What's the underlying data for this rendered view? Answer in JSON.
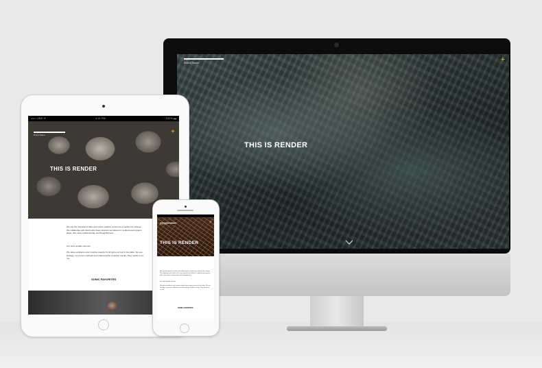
{
  "brand": {
    "logo_text": "Brand Name"
  },
  "imac": {
    "hero_title": "THIS IS RENDER",
    "menu_icon": "plus-icon",
    "scroll_icon": "chevron-down-icon"
  },
  "ipad": {
    "status_left": "••••○ UBS ✈",
    "status_time": "4:21 PM",
    "status_right": "⸬ 100% ▬",
    "hero_title": "THIS IS RENDER",
    "intro_paragraph": "We use the potential of video and motion graphic content as a medium for change. We collaborate with clients who have missions we believe in: audience-led organic ideas, who value craftsmanship and thoughtfulness.",
    "subheading": "Our work speaks volumes.",
    "values_paragraph": "We value excellence and creative integrity by bringing our best in the table. We use strategy, our proven methods and craftsmanship to deliver results. They matter to us, too.",
    "cta_label": "SONIC FAVORITES"
  },
  "iphone": {
    "hero_title": "THIS IS RENDER",
    "intro_paragraph": "We use the potential of video and motion graphic content as a medium for change. We collaborate with clients who have missions we believe in: audience-led organic ideas, who value craftsmanship and thoughtfulness.",
    "subheading": "Our work speaks volumes.",
    "values_paragraph": "We value excellence and creative integrity by bringing our best in the table. We use strategy, our proven methods and craftsmanship to deliver results. They matter to us, too.",
    "cta_label": "SONIC FAVORITES"
  },
  "colors": {
    "accent": "#e8c13a",
    "background": "#e9e9e9"
  }
}
